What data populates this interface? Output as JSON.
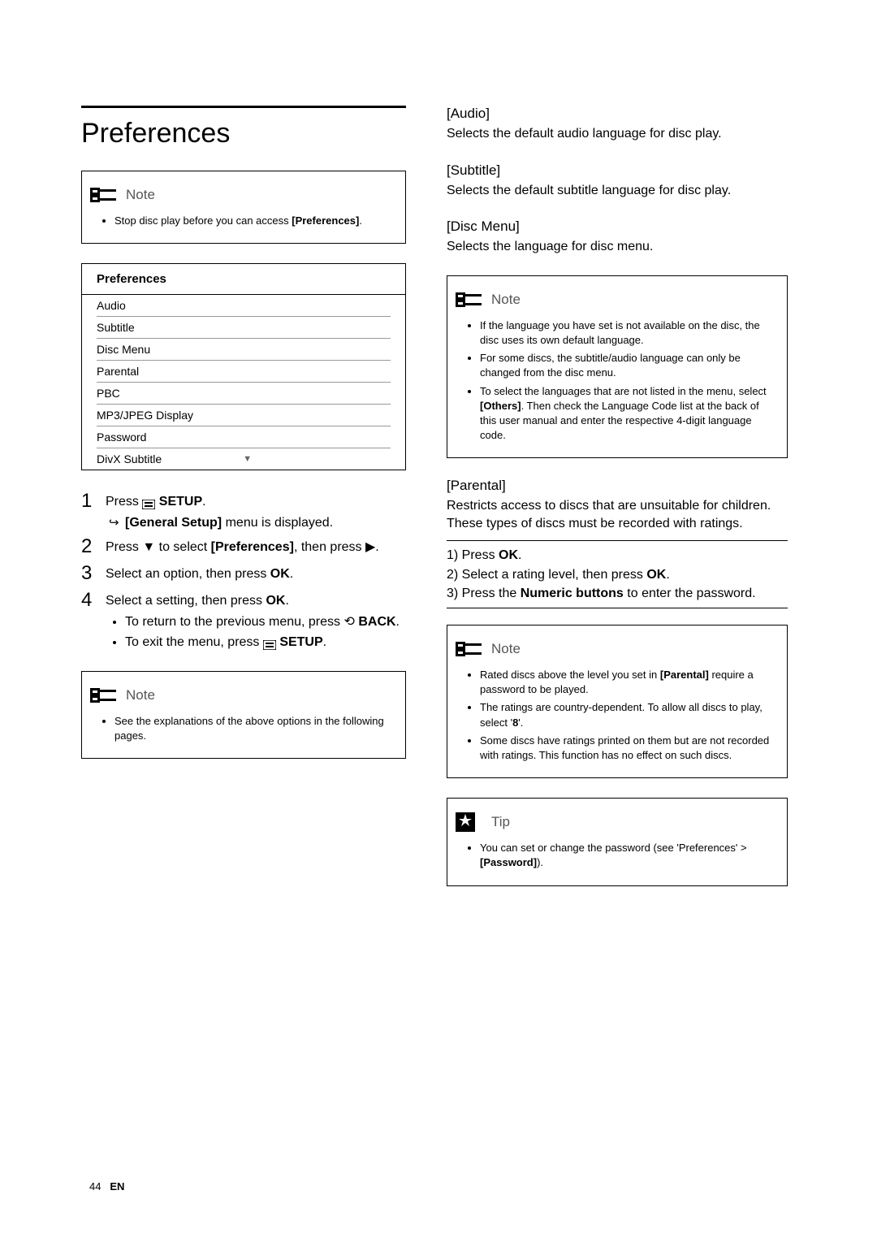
{
  "left": {
    "title": "Preferences",
    "note1_label": "Note",
    "note1_items": [
      "Stop disc play before you can access [Preferences]."
    ],
    "pref_table": {
      "header": "Preferences",
      "rows": [
        "Audio",
        "Subtitle",
        "Disc Menu",
        "Parental",
        "PBC",
        "MP3/JPEG Display",
        "Password",
        "DivX Subtitle"
      ]
    },
    "steps": {
      "s1_text1": "Press ",
      "s1_setup": " SETUP",
      "s1_sub_bold": "[General Setup]",
      "s1_sub_rest": " menu is displayed.",
      "s2_text1": "Press ▼ to select ",
      "s2_bold": "[Preferences]",
      "s2_text2": ", then press ▶.",
      "s3_text1": "Select an option, then press ",
      "s3_bold": "OK",
      "s3_text2": ".",
      "s4_text1": "Select a setting, then press ",
      "s4_bold": "OK",
      "s4_text2": ".",
      "s4_b1_text1": "To return to the previous menu, press ",
      "s4_b1_back": " BACK",
      "s4_b1_text2": ".",
      "s4_b2_text1": "To exit the menu, press ",
      "s4_b2_setup": " SETUP",
      "s4_b2_text2": "."
    },
    "note2_label": "Note",
    "note2_items": [
      "See the explanations of the above options in the following pages."
    ]
  },
  "right": {
    "audio_h": "[Audio]",
    "audio_d": "Selects the default audio language for disc play.",
    "subtitle_h": "[Subtitle]",
    "subtitle_d": "Selects the default subtitle language for disc play.",
    "discmenu_h": "[Disc Menu]",
    "discmenu_d": "Selects the language for disc menu.",
    "note1_label": "Note",
    "note1_items": [
      "If the language you have set is not available on the disc, the disc uses its own default language.",
      "For some discs, the subtitle/audio language can only be changed from the disc menu.",
      "To select the languages that are not listed in the menu, select [Others]. Then check the Language Code list at the back of this user manual and enter the respective 4-digit language code."
    ],
    "parental_h": "[Parental]",
    "parental_d": "Restricts access to discs that are unsuitable for children. These types of discs must be recorded with ratings.",
    "parental_steps": {
      "l1_a": "1) Press ",
      "l1_b": "OK",
      "l1_c": ".",
      "l2_a": "2) Select a rating level, then press ",
      "l2_b": "OK",
      "l2_c": ".",
      "l3_a": "3) Press the ",
      "l3_b": "Numeric buttons",
      "l3_c": " to enter the password."
    },
    "note2_label": "Note",
    "note2_items": [
      "Rated discs above the level you set in [Parental] require a password to be played.",
      "The ratings are country-dependent. To allow all discs to play, select '8'.",
      "Some discs have ratings printed on them but are not recorded with ratings. This function has no effect on such discs."
    ],
    "tip_label": "Tip",
    "tip_items": [
      "You can set or change the password (see 'Preferences' > [Password])."
    ]
  },
  "footer": {
    "page": "44",
    "lang": "EN"
  }
}
